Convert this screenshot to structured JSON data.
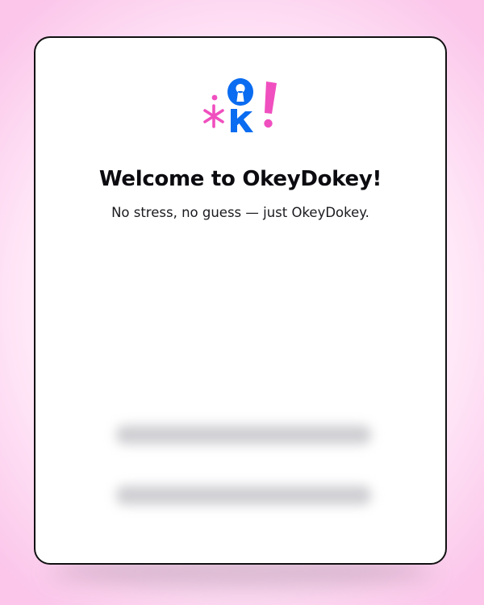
{
  "app": {
    "title": "Welcome to OkeyDokey!",
    "subtitle": "No stress, no guess — just OkeyDokey."
  },
  "logo": {
    "name": "okeydokey-logo",
    "brand_text": "ok!",
    "colors": {
      "blue": "#0a6cf0",
      "pink": "#f04fbf"
    }
  },
  "colors": {
    "background_edge": "#fbc6ea",
    "card": "#ffffff",
    "card_border": "#111111",
    "text": "#0b0b10"
  }
}
